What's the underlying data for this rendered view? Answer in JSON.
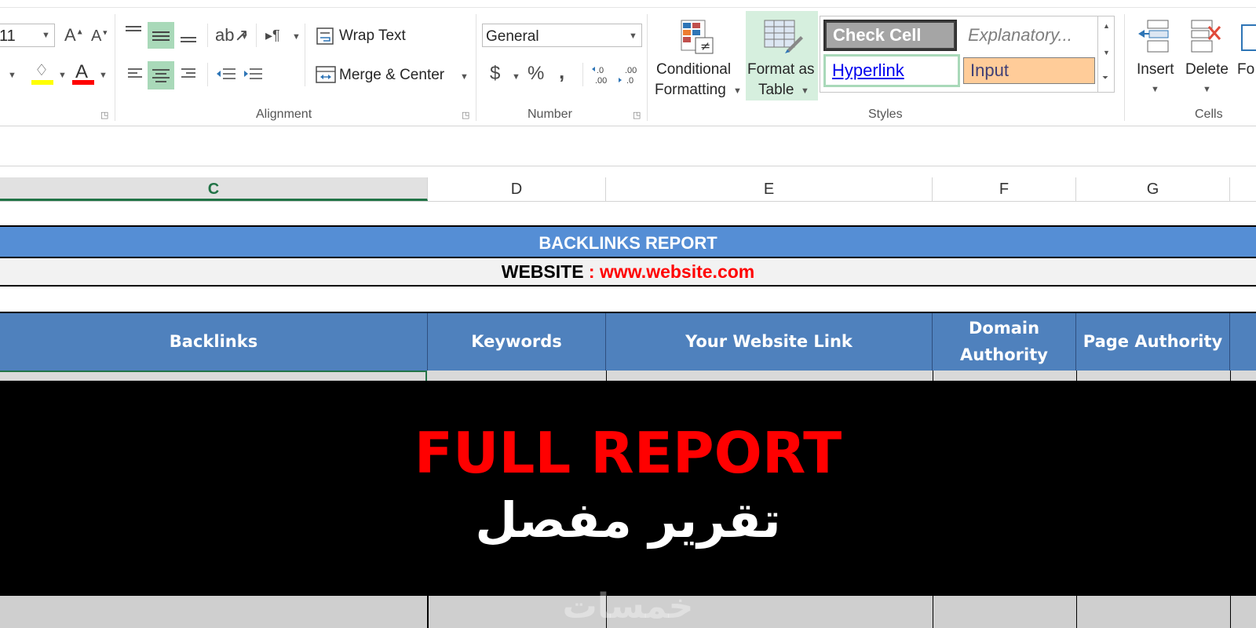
{
  "ribbon": {
    "font": {
      "size": "11",
      "grow_icon": "A",
      "shrink_icon": "A",
      "font_color_icon": "A"
    },
    "alignment": {
      "wrap_text": "Wrap Text",
      "merge_center": "Merge & Center",
      "label": "Alignment"
    },
    "number": {
      "format": "General",
      "currency": "$",
      "percent": "%",
      "comma": ",",
      "label": "Number"
    },
    "styles": {
      "conditional_formatting": [
        "Conditional",
        "Formatting"
      ],
      "format_as_table": [
        "Format as",
        "Table"
      ],
      "check_cell": "Check Cell",
      "explanatory": "Explanatory...",
      "hyperlink": "Hyperlink",
      "input": "Input",
      "label": "Styles"
    },
    "cells": {
      "insert": "Insert",
      "delete": "Delete",
      "format_partial": "Fo",
      "label": "Cells"
    }
  },
  "columns": [
    "C",
    "D",
    "E",
    "F",
    "G"
  ],
  "sheet": {
    "title": "BACKLINKS REPORT",
    "website_label": "WEBSITE",
    "website_separator": ":",
    "website_url": "www.website.com",
    "headers": [
      "Backlinks",
      "Keywords",
      "Your Website Link",
      "Domain Authority",
      "Page Authority"
    ]
  },
  "overlay": {
    "title": "FULL REPORT",
    "subtitle": "تقرير مفصل",
    "watermark": "خمسات"
  },
  "colors": {
    "title_blue": "#558ed5",
    "header_blue": "#4f81bd",
    "url_red": "#ff0000",
    "overlay_red": "#ff0000",
    "ribbon_selected": "#a9d9b9"
  }
}
